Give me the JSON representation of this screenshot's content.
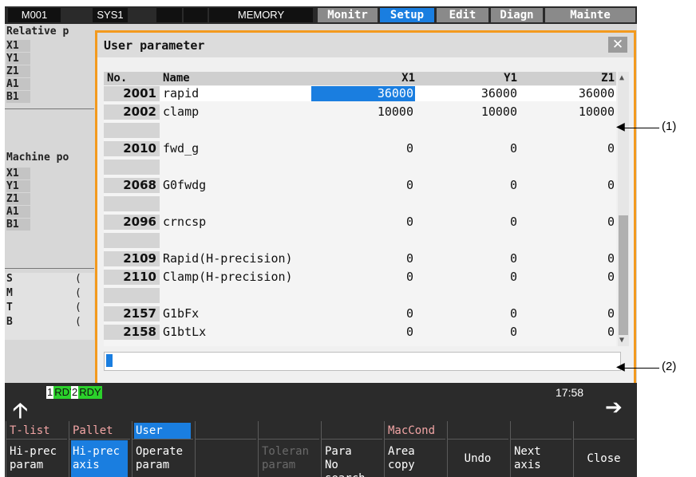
{
  "topbar": {
    "machine": "M001",
    "system": "SYS1",
    "blank1": "",
    "blank2": "",
    "memory": "MEMORY",
    "tabs": [
      "Monitr",
      "Setup",
      "Edit",
      "Diagn",
      "Mainte"
    ],
    "active_tab": "Setup"
  },
  "left_panel": {
    "relative_title": "Relative p",
    "relative_axes": [
      "X1",
      "Y1",
      "Z1",
      "A1",
      "B1"
    ],
    "machine_title": "Machine po",
    "machine_axes": [
      "X1",
      "Y1",
      "Z1",
      "A1",
      "B1"
    ],
    "codes": [
      "S",
      "M",
      "T",
      "B"
    ],
    "code_values": [
      "(",
      "(",
      "(",
      "("
    ]
  },
  "modal": {
    "title": "User parameter",
    "close_glyph": "✕",
    "headers": {
      "no": "No.",
      "name": "Name",
      "c1": "X1",
      "c2": "Y1",
      "c3": "Z1"
    },
    "rows": [
      {
        "no": "2001",
        "name": "rapid",
        "v1": "36000",
        "v2": "36000",
        "v3": "36000"
      },
      {
        "no": "2002",
        "name": "clamp",
        "v1": "10000",
        "v2": "10000",
        "v3": "10000"
      },
      {
        "no": "",
        "name": "",
        "v1": "",
        "v2": "",
        "v3": ""
      },
      {
        "no": "2010",
        "name": "fwd_g",
        "v1": "0",
        "v2": "0",
        "v3": "0"
      },
      {
        "no": "",
        "name": "",
        "v1": "",
        "v2": "",
        "v3": ""
      },
      {
        "no": "2068",
        "name": "G0fwdg",
        "v1": "0",
        "v2": "0",
        "v3": "0"
      },
      {
        "no": "",
        "name": "",
        "v1": "",
        "v2": "",
        "v3": ""
      },
      {
        "no": "2096",
        "name": "crncsp",
        "v1": "0",
        "v2": "0",
        "v3": "0"
      },
      {
        "no": "",
        "name": "",
        "v1": "",
        "v2": "",
        "v3": ""
      },
      {
        "no": "2109",
        "name": "Rapid(H-precision)",
        "v1": "0",
        "v2": "0",
        "v3": "0"
      },
      {
        "no": "2110",
        "name": "Clamp(H-precision)",
        "v1": "0",
        "v2": "0",
        "v3": "0"
      },
      {
        "no": "",
        "name": "",
        "v1": "",
        "v2": "",
        "v3": ""
      },
      {
        "no": "2157",
        "name": "G1bFx",
        "v1": "0",
        "v2": "0",
        "v3": "0"
      },
      {
        "no": "2158",
        "name": "G1btLx",
        "v1": "0",
        "v2": "0",
        "v3": "0"
      }
    ],
    "scroll_up": "▲",
    "scroll_down": "▼",
    "input_value": ""
  },
  "status": {
    "rdy1_num": "1",
    "rdy1": "RDY",
    "rdy2_num": "2",
    "rdy2": "RDY",
    "clock": "17:58",
    "up_arrow": "🡡",
    "right_arrow": "➔"
  },
  "menu": [
    {
      "top": "T-list",
      "bottom": "Hi-prec param",
      "top_on": false,
      "bottom_on": false,
      "dim": false
    },
    {
      "top": "Pallet",
      "bottom": "Hi-prec axis",
      "top_on": false,
      "bottom_on": true,
      "dim": false
    },
    {
      "top": "User",
      "bottom": "Operate param",
      "top_on": true,
      "bottom_on": false,
      "dim": false
    },
    {
      "top": "",
      "bottom": "",
      "top_on": false,
      "bottom_on": false,
      "dim": false
    },
    {
      "top": "",
      "bottom": "Toleran param",
      "top_on": false,
      "bottom_on": false,
      "dim": true
    },
    {
      "top": "",
      "bottom": "Para No search",
      "top_on": false,
      "bottom_on": false,
      "dim": false
    },
    {
      "top": "MacCond",
      "bottom": "Area copy",
      "top_on": false,
      "bottom_on": false,
      "dim": false
    },
    {
      "top": "",
      "bottom": "Undo",
      "top_on": false,
      "bottom_on": false,
      "dim": false
    },
    {
      "top": "",
      "bottom": "Next axis",
      "top_on": false,
      "bottom_on": false,
      "dim": false
    },
    {
      "top": "",
      "bottom": "Close",
      "top_on": false,
      "bottom_on": false,
      "dim": false
    }
  ],
  "callouts": {
    "one": "(1)",
    "two": "(2)"
  }
}
